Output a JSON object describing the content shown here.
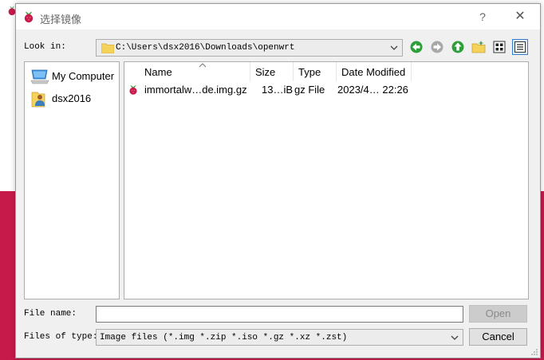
{
  "window": {
    "title": "选择镜像",
    "help_label": "?",
    "close_label": "✕"
  },
  "look_in": {
    "label": "Look in:",
    "path": "C:\\Users\\dsx2016\\Downloads\\openwrt"
  },
  "icons": {
    "back": "back-arrow-icon",
    "forward": "forward-arrow-icon",
    "up": "up-arrow-icon",
    "new_folder": "new-folder-icon",
    "list_view": "list-view-icon",
    "detail_view": "detail-view-icon"
  },
  "sidebar": {
    "items": [
      {
        "label": "My Computer",
        "icon": "computer-icon"
      },
      {
        "label": "dsx2016",
        "icon": "user-folder-icon"
      }
    ]
  },
  "files": {
    "columns": [
      "Name",
      "Size",
      "Type",
      "Date Modified"
    ],
    "rows": [
      {
        "name": "immortalw…de.img.gz",
        "size": "13…iB",
        "type": "gz File",
        "date": "2023/4… 22:26"
      }
    ]
  },
  "file_name": {
    "label": "File name:",
    "value": ""
  },
  "file_type": {
    "label": "Files of type:",
    "value": "Image files (*.img *.zip *.iso *.gz *.xz *.zst)"
  },
  "buttons": {
    "open": "Open",
    "cancel": "Cancel"
  },
  "colors": {
    "background_accent": "#c51a4a",
    "nav_green": "#2e9e3a",
    "folder_yellow": "#f5d25a"
  }
}
